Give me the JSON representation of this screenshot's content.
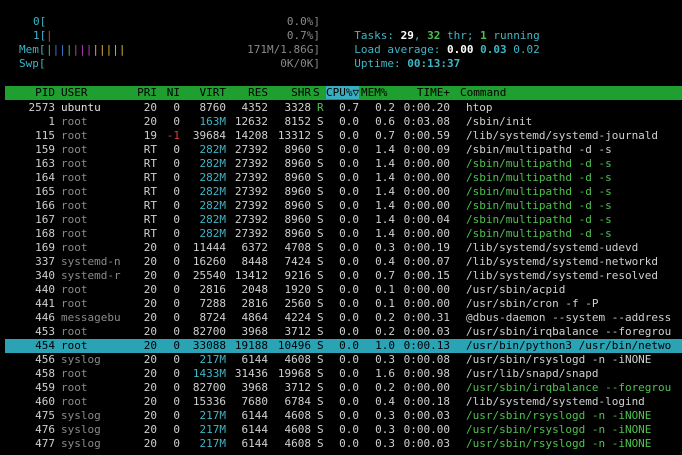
{
  "meters": {
    "cpu0": {
      "label": "0[",
      "value": "0.0%]"
    },
    "cpu1": {
      "label": "1[",
      "bar": "|",
      "value": "0.7%]"
    },
    "mem": {
      "label": "Mem[",
      "bar": "|||||||||||",
      "value": "171M/1.86G]"
    },
    "swp": {
      "label": "Swp[",
      "value": "0K/0K]"
    }
  },
  "summary": {
    "tasks_label": "Tasks: ",
    "tasks": "29",
    "comma": ", ",
    "thr": "32",
    "thr_label": " thr; ",
    "running": "1",
    "running_label": " running",
    "load_label": "Load average: ",
    "load1": "0.00",
    "load5": "0.03",
    "load15": "0.02",
    "uptime_label": "Uptime: ",
    "uptime": "00:13:37"
  },
  "header": {
    "pid": "PID",
    "user": "USER",
    "pri": "PRI",
    "ni": "NI",
    "virt": "VIRT",
    "res": "RES",
    "shr": "SHR",
    "s": "S",
    "cpu": "CPU%▽",
    "mem": "MEM%",
    "time": "TIME+",
    "command": "Command"
  },
  "processes": [
    {
      "pid": "2573",
      "user": "ubuntu",
      "pri": "20",
      "ni": "0",
      "virt": "8760",
      "res": "4352",
      "shr": "3328",
      "s": "R",
      "cpu": "0.7",
      "mem": "0.2",
      "time": "0:00.20",
      "cmd": "htop"
    },
    {
      "pid": "1",
      "user": "root",
      "pri": "20",
      "ni": "0",
      "virt": "163M",
      "res": "12632",
      "shr": "8152",
      "s": "S",
      "cpu": "0.0",
      "mem": "0.6",
      "time": "0:03.08",
      "cmd": "/sbin/init"
    },
    {
      "pid": "115",
      "user": "root",
      "pri": "19",
      "ni": "-1",
      "virt": "39684",
      "res": "14208",
      "shr": "13312",
      "s": "S",
      "cpu": "0.0",
      "mem": "0.7",
      "time": "0:00.59",
      "cmd": "/lib/systemd/systemd-journald"
    },
    {
      "pid": "159",
      "user": "root",
      "pri": "RT",
      "ni": "0",
      "virt": "282M",
      "res": "27392",
      "shr": "8960",
      "s": "S",
      "cpu": "0.0",
      "mem": "1.4",
      "time": "0:00.09",
      "cmd": "/sbin/multipathd -d -s"
    },
    {
      "pid": "163",
      "user": "root",
      "pri": "RT",
      "ni": "0",
      "virt": "282M",
      "res": "27392",
      "shr": "8960",
      "s": "S",
      "cpu": "0.0",
      "mem": "1.4",
      "time": "0:00.00",
      "cmd": "/sbin/multipathd -d -s",
      "thread": true
    },
    {
      "pid": "164",
      "user": "root",
      "pri": "RT",
      "ni": "0",
      "virt": "282M",
      "res": "27392",
      "shr": "8960",
      "s": "S",
      "cpu": "0.0",
      "mem": "1.4",
      "time": "0:00.00",
      "cmd": "/sbin/multipathd -d -s",
      "thread": true
    },
    {
      "pid": "165",
      "user": "root",
      "pri": "RT",
      "ni": "0",
      "virt": "282M",
      "res": "27392",
      "shr": "8960",
      "s": "S",
      "cpu": "0.0",
      "mem": "1.4",
      "time": "0:00.00",
      "cmd": "/sbin/multipathd -d -s",
      "thread": true
    },
    {
      "pid": "166",
      "user": "root",
      "pri": "RT",
      "ni": "0",
      "virt": "282M",
      "res": "27392",
      "shr": "8960",
      "s": "S",
      "cpu": "0.0",
      "mem": "1.4",
      "time": "0:00.00",
      "cmd": "/sbin/multipathd -d -s",
      "thread": true
    },
    {
      "pid": "167",
      "user": "root",
      "pri": "RT",
      "ni": "0",
      "virt": "282M",
      "res": "27392",
      "shr": "8960",
      "s": "S",
      "cpu": "0.0",
      "mem": "1.4",
      "time": "0:00.04",
      "cmd": "/sbin/multipathd -d -s",
      "thread": true
    },
    {
      "pid": "168",
      "user": "root",
      "pri": "RT",
      "ni": "0",
      "virt": "282M",
      "res": "27392",
      "shr": "8960",
      "s": "S",
      "cpu": "0.0",
      "mem": "1.4",
      "time": "0:00.00",
      "cmd": "/sbin/multipathd -d -s",
      "thread": true
    },
    {
      "pid": "169",
      "user": "root",
      "pri": "20",
      "ni": "0",
      "virt": "11444",
      "res": "6372",
      "shr": "4708",
      "s": "S",
      "cpu": "0.0",
      "mem": "0.3",
      "time": "0:00.19",
      "cmd": "/lib/systemd/systemd-udevd"
    },
    {
      "pid": "337",
      "user": "systemd-n",
      "pri": "20",
      "ni": "0",
      "virt": "16260",
      "res": "8448",
      "shr": "7424",
      "s": "S",
      "cpu": "0.0",
      "mem": "0.4",
      "time": "0:00.07",
      "cmd": "/lib/systemd/systemd-networkd"
    },
    {
      "pid": "340",
      "user": "systemd-r",
      "pri": "20",
      "ni": "0",
      "virt": "25540",
      "res": "13412",
      "shr": "9216",
      "s": "S",
      "cpu": "0.0",
      "mem": "0.7",
      "time": "0:00.15",
      "cmd": "/lib/systemd/systemd-resolved"
    },
    {
      "pid": "440",
      "user": "root",
      "pri": "20",
      "ni": "0",
      "virt": "2816",
      "res": "2048",
      "shr": "1920",
      "s": "S",
      "cpu": "0.0",
      "mem": "0.1",
      "time": "0:00.00",
      "cmd": "/usr/sbin/acpid"
    },
    {
      "pid": "441",
      "user": "root",
      "pri": "20",
      "ni": "0",
      "virt": "7288",
      "res": "2816",
      "shr": "2560",
      "s": "S",
      "cpu": "0.0",
      "mem": "0.1",
      "time": "0:00.00",
      "cmd": "/usr/sbin/cron -f -P"
    },
    {
      "pid": "446",
      "user": "messagebu",
      "pri": "20",
      "ni": "0",
      "virt": "8724",
      "res": "4864",
      "shr": "4224",
      "s": "S",
      "cpu": "0.0",
      "mem": "0.2",
      "time": "0:00.31",
      "cmd": "@dbus-daemon --system --address"
    },
    {
      "pid": "453",
      "user": "root",
      "pri": "20",
      "ni": "0",
      "virt": "82700",
      "res": "3968",
      "shr": "3712",
      "s": "S",
      "cpu": "0.0",
      "mem": "0.2",
      "time": "0:00.03",
      "cmd": "/usr/sbin/irqbalance --foregrou"
    },
    {
      "pid": "454",
      "user": "root",
      "pri": "20",
      "ni": "0",
      "virt": "33088",
      "res": "19188",
      "shr": "10496",
      "s": "S",
      "cpu": "0.0",
      "mem": "1.0",
      "time": "0:00.13",
      "cmd": "/usr/bin/python3 /usr/bin/netwo",
      "selected": true
    },
    {
      "pid": "456",
      "user": "syslog",
      "pri": "20",
      "ni": "0",
      "virt": "217M",
      "res": "6144",
      "shr": "4608",
      "s": "S",
      "cpu": "0.0",
      "mem": "0.3",
      "time": "0:00.08",
      "cmd": "/usr/sbin/rsyslogd -n -iNONE"
    },
    {
      "pid": "458",
      "user": "root",
      "pri": "20",
      "ni": "0",
      "virt": "1433M",
      "res": "31436",
      "shr": "19968",
      "s": "S",
      "cpu": "0.0",
      "mem": "1.6",
      "time": "0:00.98",
      "cmd": "/usr/lib/snapd/snapd"
    },
    {
      "pid": "459",
      "user": "root",
      "pri": "20",
      "ni": "0",
      "virt": "82700",
      "res": "3968",
      "shr": "3712",
      "s": "S",
      "cpu": "0.0",
      "mem": "0.2",
      "time": "0:00.00",
      "cmd": "/usr/sbin/irqbalance --foregrou",
      "thread": true
    },
    {
      "pid": "460",
      "user": "root",
      "pri": "20",
      "ni": "0",
      "virt": "15336",
      "res": "7680",
      "shr": "6784",
      "s": "S",
      "cpu": "0.0",
      "mem": "0.4",
      "time": "0:00.18",
      "cmd": "/lib/systemd/systemd-logind"
    },
    {
      "pid": "475",
      "user": "syslog",
      "pri": "20",
      "ni": "0",
      "virt": "217M",
      "res": "6144",
      "shr": "4608",
      "s": "S",
      "cpu": "0.0",
      "mem": "0.3",
      "time": "0:00.03",
      "cmd": "/usr/sbin/rsyslogd -n -iNONE",
      "thread": true
    },
    {
      "pid": "476",
      "user": "syslog",
      "pri": "20",
      "ni": "0",
      "virt": "217M",
      "res": "6144",
      "shr": "4608",
      "s": "S",
      "cpu": "0.0",
      "mem": "0.3",
      "time": "0:00.00",
      "cmd": "/usr/sbin/rsyslogd -n -iNONE",
      "thread": true
    },
    {
      "pid": "477",
      "user": "syslog",
      "pri": "20",
      "ni": "0",
      "virt": "217M",
      "res": "6144",
      "shr": "4608",
      "s": "S",
      "cpu": "0.0",
      "mem": "0.3",
      "time": "0:00.03",
      "cmd": "/usr/sbin/rsyslogd -n -iNONE",
      "thread": true
    }
  ]
}
